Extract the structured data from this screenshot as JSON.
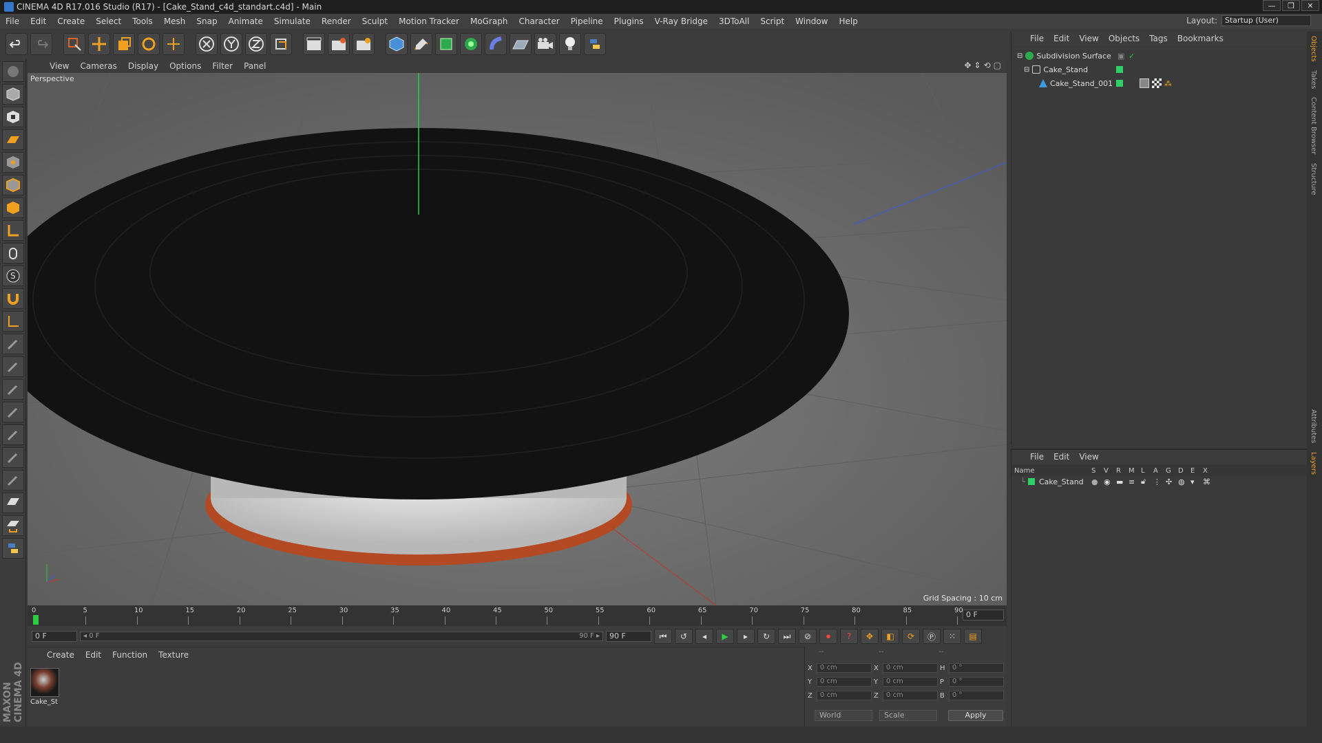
{
  "window": {
    "title": "CINEMA 4D R17.016 Studio (R17) - [Cake_Stand_c4d_standart.c4d] - Main",
    "minimize": "—",
    "maximize": "❐",
    "close": "✕"
  },
  "menubar": {
    "items": [
      "File",
      "Edit",
      "Create",
      "Select",
      "Tools",
      "Mesh",
      "Snap",
      "Animate",
      "Simulate",
      "Render",
      "Sculpt",
      "Motion Tracker",
      "MoGraph",
      "Character",
      "Pipeline",
      "Plugins",
      "V-Ray Bridge",
      "3DToAll",
      "Script",
      "Window",
      "Help"
    ],
    "layout_label": "Layout:",
    "layout_value": "Startup (User)"
  },
  "viewport": {
    "menu": [
      "View",
      "Cameras",
      "Display",
      "Options",
      "Filter",
      "Panel"
    ],
    "label": "Perspective",
    "grid_spacing": "Grid Spacing : 10 cm"
  },
  "timeline": {
    "ticks": [
      "0",
      "5",
      "10",
      "15",
      "20",
      "25",
      "30",
      "35",
      "40",
      "45",
      "50",
      "55",
      "60",
      "65",
      "70",
      "75",
      "80",
      "85",
      "90"
    ],
    "current_frame": "0 F"
  },
  "transport": {
    "start_field": "0 F",
    "slider_left": "◂ 0 F",
    "slider_right": "90 F ▸",
    "end_field": "90 F"
  },
  "materials": {
    "menu": [
      "Create",
      "Edit",
      "Function",
      "Texture"
    ],
    "items": [
      {
        "label": "Cake_St"
      }
    ]
  },
  "coords": {
    "header": [
      "--",
      "--",
      "--"
    ],
    "rows": [
      {
        "a": "X",
        "av": "0 cm",
        "b": "X",
        "bv": "0 cm",
        "c": "H",
        "cv": "0 °"
      },
      {
        "a": "Y",
        "av": "0 cm",
        "b": "Y",
        "bv": "0 cm",
        "c": "P",
        "cv": "0 °"
      },
      {
        "a": "Z",
        "av": "0 cm",
        "b": "Z",
        "bv": "0 cm",
        "c": "B",
        "cv": "0 °"
      }
    ],
    "mode": "World",
    "transform": "Scale",
    "apply": "Apply"
  },
  "objects": {
    "menu": [
      "File",
      "Edit",
      "View",
      "Objects",
      "Tags",
      "Bookmarks"
    ],
    "tree": [
      "Subdivision Surface",
      "Cake_Stand",
      "Cake_Stand_001"
    ]
  },
  "layers": {
    "menu": [
      "File",
      "Edit",
      "View"
    ],
    "columns": [
      "Name",
      "S",
      "V",
      "R",
      "M",
      "L",
      "A",
      "G",
      "D",
      "E",
      "X"
    ],
    "rows": [
      {
        "name": "Cake_Stand"
      }
    ]
  },
  "sidetabs": [
    "Objects",
    "Takes",
    "Content Browser",
    "Structure",
    "Attributes",
    "Layers"
  ],
  "colors": {
    "accent": "#f0a020",
    "layer_green": "#2fcf6a",
    "axis_red": "#c0392b",
    "axis_green": "#2ecc40",
    "axis_blue": "#3b5bdb"
  }
}
